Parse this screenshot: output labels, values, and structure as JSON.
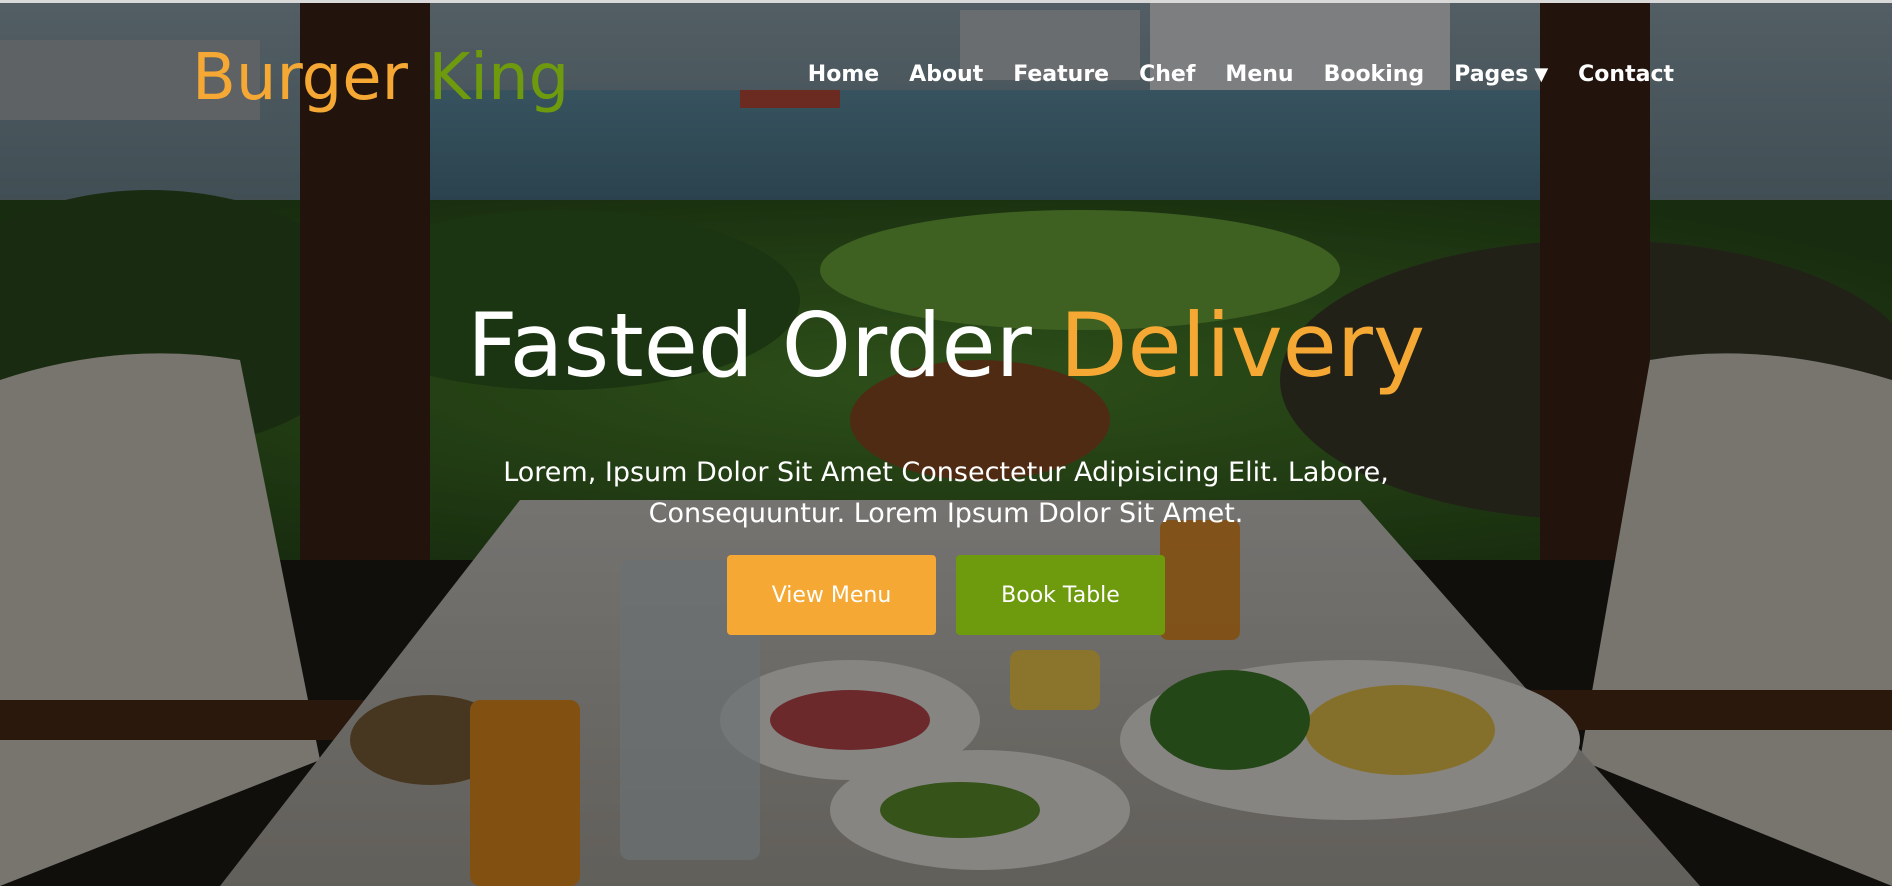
{
  "brand": {
    "name_part1": "Burger ",
    "name_part2": "King",
    "color_primary": "#f5a833",
    "color_secondary": "#6e9a0e"
  },
  "nav": {
    "items": [
      {
        "label": "Home"
      },
      {
        "label": "About"
      },
      {
        "label": "Feature"
      },
      {
        "label": "Chef"
      },
      {
        "label": "Menu"
      },
      {
        "label": "Booking"
      },
      {
        "label": "Pages",
        "has_dropdown": true,
        "icon": "caret-down-icon"
      },
      {
        "label": "Contact"
      }
    ]
  },
  "hero": {
    "title_main": "Fasted Order ",
    "title_accent": "Delivery",
    "text_line1": "Lorem, Ipsum Dolor Sit Amet Consectetur Adipisicing Elit. Labore,",
    "text_line2": "Consequuntur. Lorem Ipsum Dolor Sit Amet.",
    "buttons": {
      "primary_label": "View Menu",
      "secondary_label": "Book Table"
    },
    "background": "restaurant-table-with-food-by-window"
  }
}
